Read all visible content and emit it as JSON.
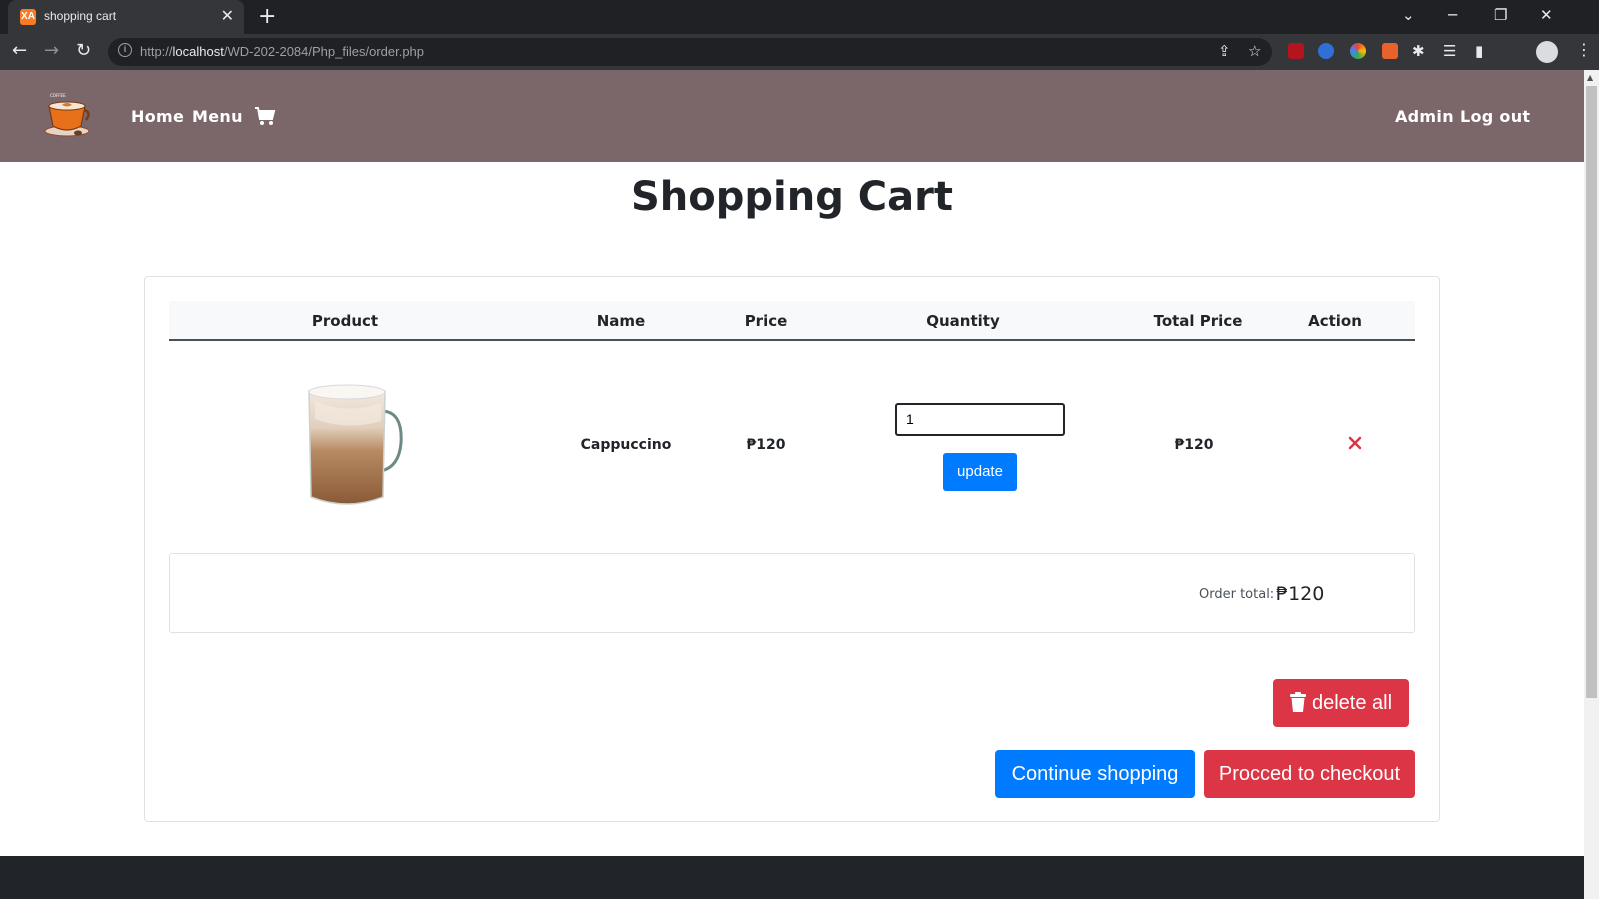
{
  "browser": {
    "tab_title": "shopping cart",
    "favicon_label": "XA",
    "url_host": "localhost",
    "url_prefix": "http://",
    "url_path": "/WD-202-2084/Php_files/order.php"
  },
  "navbar": {
    "home": "Home",
    "menu": "Menu",
    "admin": "Admin",
    "logout": "Log out",
    "logo_text": "COFFEE"
  },
  "page": {
    "title": "Shopping Cart"
  },
  "table": {
    "headers": [
      "Product",
      "Name",
      "Price",
      "Quantity",
      "Total Price",
      "Action"
    ],
    "rows": [
      {
        "name": "Cappuccino",
        "price": "₱120",
        "quantity": "1",
        "total": "₱120",
        "update_label": "update"
      }
    ]
  },
  "summary": {
    "order_total_label": "Order total:",
    "order_total_value": "₱120"
  },
  "actions": {
    "delete_all": "delete all",
    "continue_shopping": "Continue shopping",
    "checkout": "Procced to checkout"
  },
  "colors": {
    "navbar": "#7b6769",
    "primary": "#007bff",
    "danger": "#dc3545",
    "footer": "#212529"
  }
}
